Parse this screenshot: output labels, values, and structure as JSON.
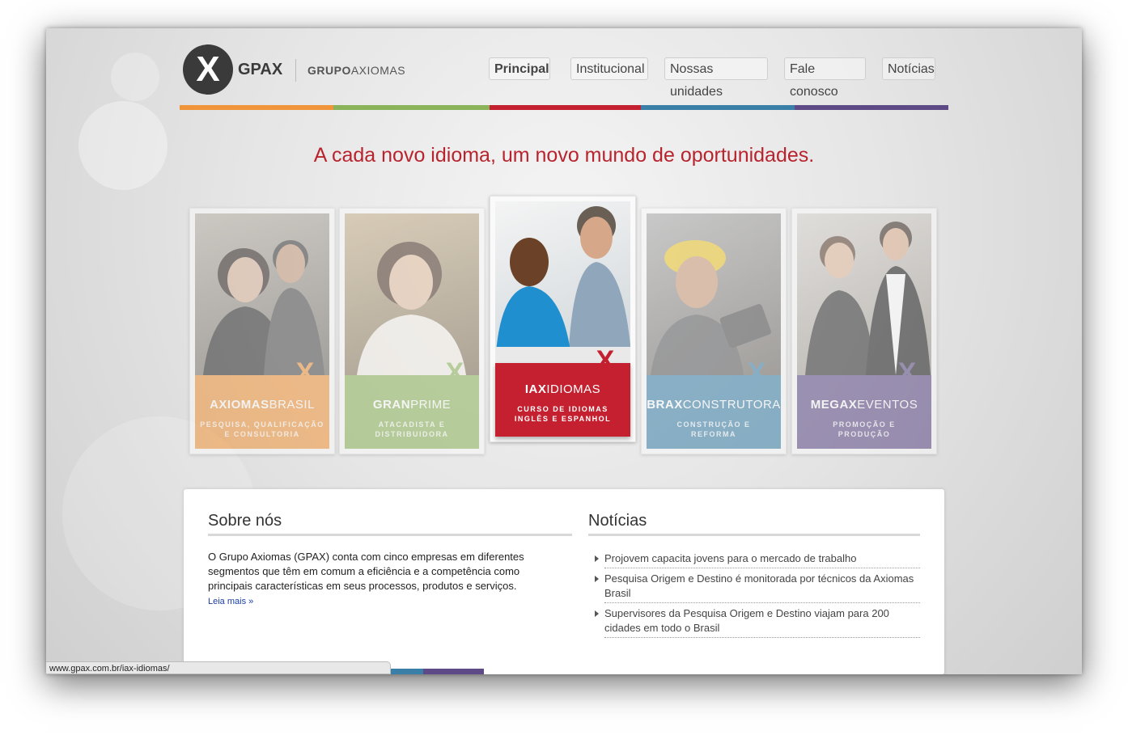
{
  "logo": {
    "mark": "X",
    "brand": "GPAX",
    "group_bold": "GRUPO",
    "group_light": "AXIOMAS"
  },
  "nav": [
    {
      "label": "Principal",
      "active": true
    },
    {
      "label": "Institucional"
    },
    {
      "label": "Nossas unidades"
    },
    {
      "label": "Fale conosco"
    },
    {
      "label": "Notícias"
    }
  ],
  "colors": {
    "orange": "#f0953a",
    "green": "#8bb35a",
    "red": "#c4202f",
    "blue": "#3a7fa8",
    "purple": "#5d4a86",
    "accent": "#b8242e"
  },
  "tagline": "A cada novo idioma, um novo mundo de oportunidades.",
  "cards": [
    {
      "name_bold": "AXIOMAS",
      "name_light": "BRASIL",
      "sub1": "PESQUISA, QUALIFICAÇÃO",
      "sub2": "E CONSULTORIA",
      "color": "#f0953a"
    },
    {
      "name_bold": "GRAN",
      "name_light": "PRIME",
      "sub1": "ATACADISTA E",
      "sub2": "DISTRIBUIDORA",
      "color": "#8bb35a"
    },
    {
      "name_bold": "IAX",
      "name_light": "IDIOMAS",
      "sub1": "CURSO DE IDIOMAS",
      "sub2": "INGLÊS E ESPANHOL",
      "color": "#c4202f"
    },
    {
      "name_bold": "BRAX",
      "name_light": "CONSTRUTORA",
      "sub1": "CONSTRUÇÃO E",
      "sub2": "REFORMA",
      "color": "#3a7fa8"
    },
    {
      "name_bold": "MEGAX",
      "name_light": "EVENTOS",
      "sub1": "PROMOÇÃO E",
      "sub2": "PRODUÇÃO",
      "color": "#5d4a86"
    }
  ],
  "about": {
    "title": "Sobre nós",
    "text": "O Grupo Axiomas (GPAX) conta com cinco empresas em diferentes segmentos que têm em comum a eficiência e a competência como principais características em seus processos, produtos e serviços.",
    "read_more": "Leia mais »"
  },
  "news": {
    "title": "Notícias",
    "items": [
      "Projovem capacita jovens para o mercado de trabalho",
      "Pesquisa Origem e Destino é monitorada por técnicos da Axiomas Brasil",
      "Supervisores da Pesquisa Origem e Destino viajam para 200 cidades em todo o Brasil"
    ]
  },
  "status_url": "www.gpax.com.br/iax-idiomas/"
}
